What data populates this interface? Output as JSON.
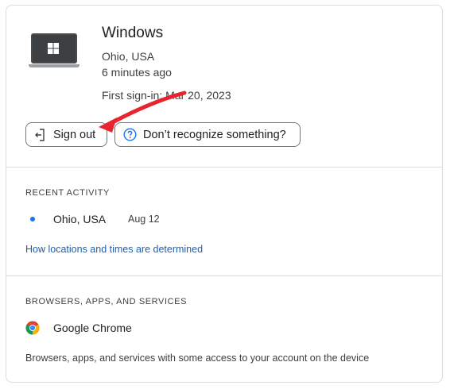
{
  "device": {
    "name": "Windows",
    "location": "Ohio, USA",
    "last_active": "6 minutes ago",
    "first_signin": "First sign-in: Mar 20, 2023"
  },
  "actions": {
    "signout_label": "Sign out",
    "recognize_label": "Don’t recognize something?"
  },
  "recent_activity": {
    "heading": "RECENT ACTIVITY",
    "items": [
      {
        "location": "Ohio, USA",
        "date": "Aug 12"
      }
    ],
    "help_link": "How locations and times are determined"
  },
  "services": {
    "heading": "BROWSERS, APPS, AND SERVICES",
    "items": [
      {
        "name": "Google Chrome",
        "icon": "chrome-icon"
      }
    ],
    "description": "Browsers, apps, and services with some access to your account on the device"
  },
  "icons": {
    "device": "laptop-icon",
    "os": "windows-logo-icon",
    "signout": "sign-out-icon",
    "help": "help-circle-icon",
    "annotation": "red-arrow-annotation"
  },
  "colors": {
    "accent": "#1a73e8",
    "link": "#1a5fb4",
    "annotation_arrow": "#e8252f",
    "border": "#dadce0"
  }
}
